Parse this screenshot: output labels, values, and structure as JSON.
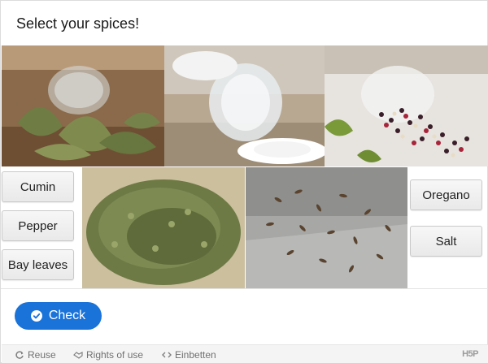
{
  "task": {
    "title": "Select your spices!"
  },
  "images": [
    {
      "name": "bay-leaves-jar-image",
      "subject": "bay leaves in glass jar"
    },
    {
      "name": "salt-shaker-image",
      "subject": "salt spilled from shaker"
    },
    {
      "name": "peppercorns-jar-image",
      "subject": "mixed peppercorns in jar"
    },
    {
      "name": "oregano-image",
      "subject": "dried oregano heap"
    },
    {
      "name": "cumin-seeds-image",
      "subject": "cumin seeds on stone"
    }
  ],
  "words": {
    "cumin": "Cumin",
    "pepper": "Pepper",
    "bay_leaves": "Bay leaves",
    "oregano": "Oregano",
    "salt": "Salt"
  },
  "actions": {
    "check_label": "Check",
    "check_icon": "check-circle-icon"
  },
  "footer": {
    "reuse": "Reuse",
    "rights": "Rights of use",
    "embed": "Einbetten",
    "brand": "H5P"
  },
  "colors": {
    "accent": "#1a73d9",
    "footer_bg": "#f4f4f4",
    "word_border": "#c9c9c9"
  }
}
